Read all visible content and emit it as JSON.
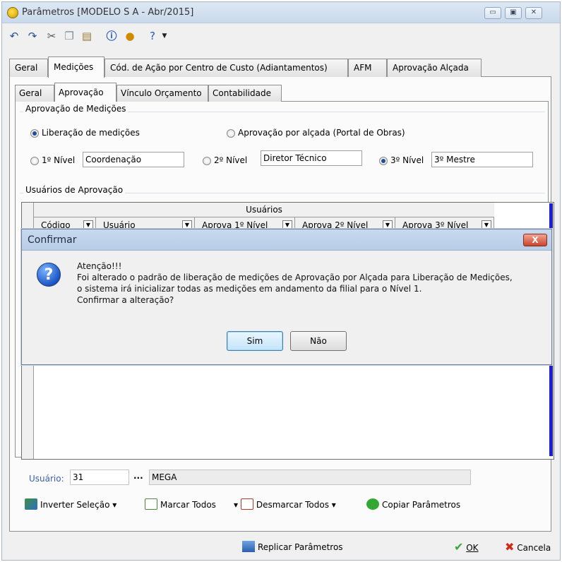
{
  "window": {
    "title": "Parâmetros [MODELO S A - Abr/2015]",
    "buttons": [
      "▭",
      "▣",
      "✕"
    ]
  },
  "toolbar": {
    "icons": [
      "undo-icon",
      "redo-icon",
      "cut-icon",
      "copy-icon",
      "paste-icon",
      "info-icon",
      "user-icon",
      "help-icon"
    ]
  },
  "tabs_main": [
    "Geral",
    "Medições",
    "Cód. de Ação por Centro de Custo (Adiantamentos)",
    "AFM",
    "Aprovação Alçada"
  ],
  "tabs_sub": [
    "Geral",
    "Aprovação",
    "Vínculo Orçamento",
    "Contabilidade"
  ],
  "approval_group": {
    "title": "Aprovação de Medições",
    "option_release": "Liberação de medições",
    "option_alcada": "Aprovação por alçada (Portal de Obras)",
    "level1_label": "1º Nível",
    "level1_value": "Coordenação",
    "level2_label": "2º Nível",
    "level2_value": "Diretor Técnico",
    "level3_label": "3º Nível",
    "level3_value": "3º Mestre"
  },
  "users_group": {
    "title": "Usuários de Aprovação",
    "band": "Usuários",
    "columns": [
      "Código",
      "Usuário",
      "Aprova 1º Nível",
      "Aprova 2º Nível",
      "Aprova 3º Nível"
    ]
  },
  "user_field": {
    "label": "Usuário:",
    "code": "31",
    "ellipsis": "...",
    "name": "MEGA"
  },
  "actions": {
    "invert": "Inverter Seleção",
    "mark_all": "Marcar Todos",
    "unmark_all": "Desmarcar Todos",
    "copy_params": "Copiar Parâmetros"
  },
  "footer": {
    "replicate": "Replicar Parâmetros",
    "ok": "OK",
    "cancel": "Cancela"
  },
  "dialog": {
    "title": "Confirmar",
    "close": "X",
    "line1": "Atenção!!!",
    "line2": "Foi alterado o padrão de liberação de medições de Aprovação por Alçada para Liberação de Medições,",
    "line3": "o sistema irá inicializar todas as medições em andamento da filial para o Nível 1.",
    "line4": "Confirmar a alteração?",
    "yes": "Sim",
    "no": "Não"
  }
}
